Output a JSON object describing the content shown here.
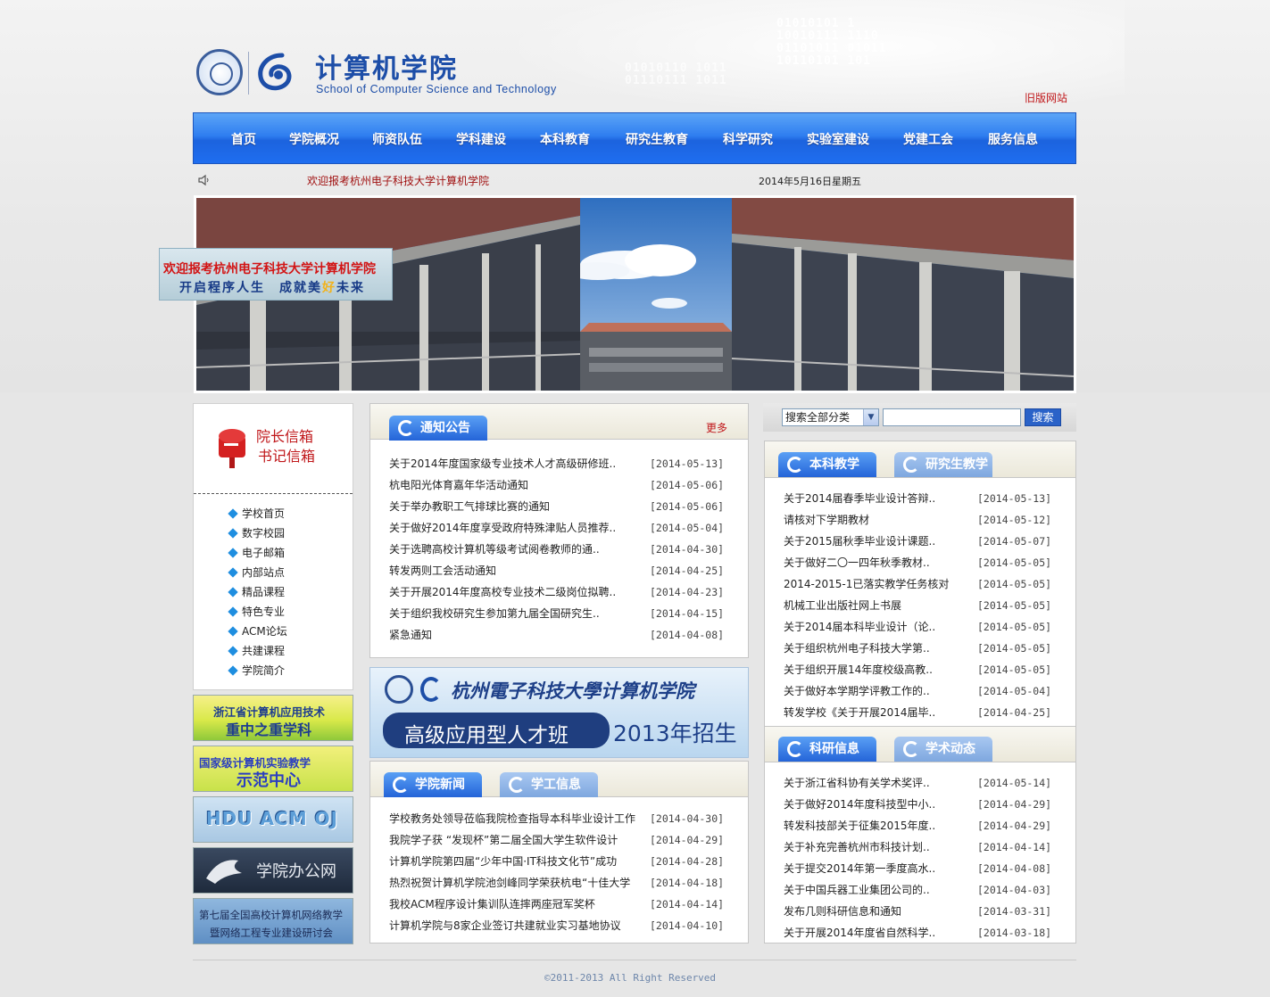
{
  "header": {
    "title": "计算机学院",
    "subtitle": "School of Computer Science and Technology",
    "old_site_link": "旧版网站"
  },
  "nav": {
    "items": [
      "首页",
      "学院概况",
      "师资队伍",
      "学科建设",
      "本科教育",
      "研究生教育",
      "科学研究",
      "实验室建设",
      "党建工会",
      "服务信息"
    ]
  },
  "ticker": {
    "welcome": "欢迎报考杭州电子科技大学计算机学院",
    "date": "2014年5月16日星期五"
  },
  "banner": {
    "headline": "欢迎报考杭州电子科技大学计算机学院",
    "slogan_a": "开启程序人生　成就美",
    "slogan_hl": "好",
    "slogan_b": "未来"
  },
  "mailbox": {
    "dean": "院长信箱",
    "secretary": "书记信箱"
  },
  "quick_links": [
    "学校首页",
    "数字校园",
    "电子邮箱",
    "内部站点",
    "精品课程",
    "特色专业",
    "ACM论坛",
    "共建课程",
    "学院简介"
  ],
  "left_ads": {
    "ad1_line1": "浙江省计算机应用技术",
    "ad1_line2": "重中之重学科",
    "ad2_line1": "国家级计算机实验教学",
    "ad2_line2": "示范中心",
    "ad3": "HDU ACM OJ",
    "ad4": "学院办公网",
    "ad5_line1": "第七届全国高校计算机网络教学",
    "ad5_line2": "暨网络工程专业建设研讨会"
  },
  "notices": {
    "tab": "通知公告",
    "more": "更多",
    "items": [
      {
        "title": "关于2014年度国家级专业技术人才高级研修班..",
        "date": "[2014-05-13]"
      },
      {
        "title": "杭电阳光体育嘉年华活动通知",
        "date": "[2014-05-06]"
      },
      {
        "title": "关于举办教职工气排球比赛的通知",
        "date": "[2014-05-06]"
      },
      {
        "title": "关于做好2014年度享受政府特殊津贴人员推荐..",
        "date": "[2014-05-04]"
      },
      {
        "title": "关于选聘高校计算机等级考试阅卷教师的通..",
        "date": "[2014-04-30]"
      },
      {
        "title": "转发两则工会活动通知",
        "date": "[2014-04-25]"
      },
      {
        "title": "关于开展2014年度高校专业技术二级岗位拟聘..",
        "date": "[2014-04-23]"
      },
      {
        "title": "关于组织我校研究生参加第九届全国研究生..",
        "date": "[2014-04-15]"
      },
      {
        "title": "紧急通知",
        "date": "[2014-04-08]"
      }
    ]
  },
  "promo": {
    "school": "杭州電子科技大學计算机学院",
    "class": "高级应用型人才班",
    "year": "2013年招生"
  },
  "news": {
    "tab_active": "学院新闻",
    "tab_other": "学工信息",
    "items": [
      {
        "title": "学校教务处领导莅临我院检查指导本科毕业设计工作",
        "date": "[2014-04-30]"
      },
      {
        "title": "我院学子获 “发现杯”第二届全国大学生软件设计",
        "date": "[2014-04-29]"
      },
      {
        "title": "计算机学院第四届“少年中国·IT科技文化节”成功",
        "date": "[2014-04-28]"
      },
      {
        "title": "热烈祝贺计算机学院池剑峰同学荣获杭电“十佳大学",
        "date": "[2014-04-18]"
      },
      {
        "title": "我校ACM程序设计集训队连摔两座冠军奖杯",
        "date": "[2014-04-14]"
      },
      {
        "title": "计算机学院与8家企业签订共建就业实习基地协议",
        "date": "[2014-04-10]"
      }
    ]
  },
  "search": {
    "category": "搜索全部分类",
    "button": "搜索",
    "value": ""
  },
  "teaching": {
    "tab_active": "本科教学",
    "tab_other": "研究生教学",
    "items": [
      {
        "title": "关于2014届春季毕业设计答辩..",
        "date": "[2014-05-13]"
      },
      {
        "title": "请核对下学期教材",
        "date": "[2014-05-12]"
      },
      {
        "title": "关于2015届秋季毕业设计课题..",
        "date": "[2014-05-07]"
      },
      {
        "title": "关于做好二〇一四年秋季教材..",
        "date": "[2014-05-05]"
      },
      {
        "title": "2014-2015-1已落实教学任务核对",
        "date": "[2014-05-05]"
      },
      {
        "title": "机械工业出版社网上书展",
        "date": "[2014-05-05]"
      },
      {
        "title": "关于2014届本科毕业设计（论..",
        "date": "[2014-05-05]"
      },
      {
        "title": "关于组织杭州电子科技大学第..",
        "date": "[2014-05-05]"
      },
      {
        "title": "关于组织开展14年度校级高教..",
        "date": "[2014-05-05]"
      },
      {
        "title": "关于做好本学期学评教工作的..",
        "date": "[2014-05-04]"
      },
      {
        "title": "转发学校《关于开展2014届毕..",
        "date": "[2014-04-25]"
      }
    ]
  },
  "research": {
    "tab_active": "科研信息",
    "tab_other": "学术动态",
    "items": [
      {
        "title": "关于浙江省科协有关学术奖评..",
        "date": "[2014-05-14]"
      },
      {
        "title": "关于做好2014年度科技型中小..",
        "date": "[2014-04-29]"
      },
      {
        "title": "转发科技部关于征集2015年度..",
        "date": "[2014-04-29]"
      },
      {
        "title": "关于补充完善杭州市科技计划..",
        "date": "[2014-04-14]"
      },
      {
        "title": "关于提交2014年第一季度高水..",
        "date": "[2014-04-08]"
      },
      {
        "title": "关于中国兵器工业集团公司的..",
        "date": "[2014-04-03]"
      },
      {
        "title": "发布几则科研信息和通知",
        "date": "[2014-03-31]"
      },
      {
        "title": "关于开展2014年度省自然科学..",
        "date": "[2014-03-18]"
      }
    ]
  },
  "footer": {
    "copyright": "©2011-2013 All Right Reserved"
  },
  "colors": {
    "brand_blue": "#1d4ea8",
    "nav_blue": "#2f7ef0",
    "link_red": "#c0171a"
  }
}
